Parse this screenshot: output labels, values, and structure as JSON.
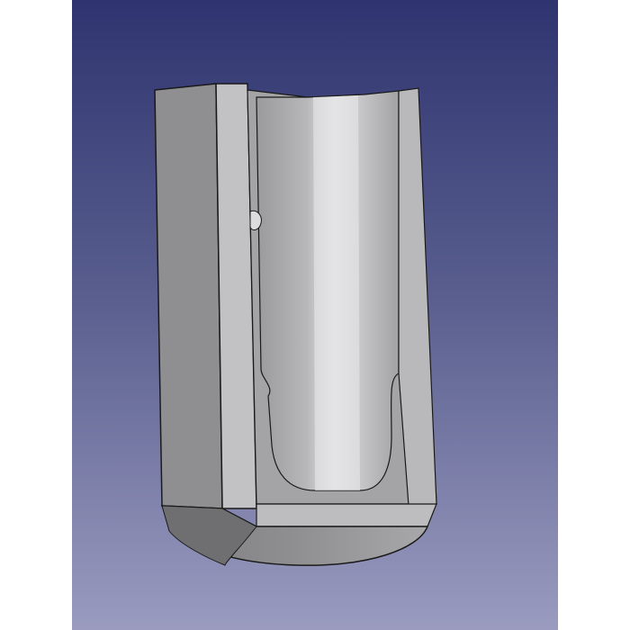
{
  "app": {
    "view": "3d-viewport",
    "background_gradient": [
      "#2f3470",
      "#5a5f8f",
      "#9a9bbf"
    ]
  },
  "model": {
    "object": "cad-part-holder",
    "colors": {
      "face_dark": "#8f8f91",
      "face_mid": "#a6a6a8",
      "face_light": "#c9c9cb",
      "face_highlight": "#e3e3e5",
      "edge": "#1a1a1a"
    }
  }
}
